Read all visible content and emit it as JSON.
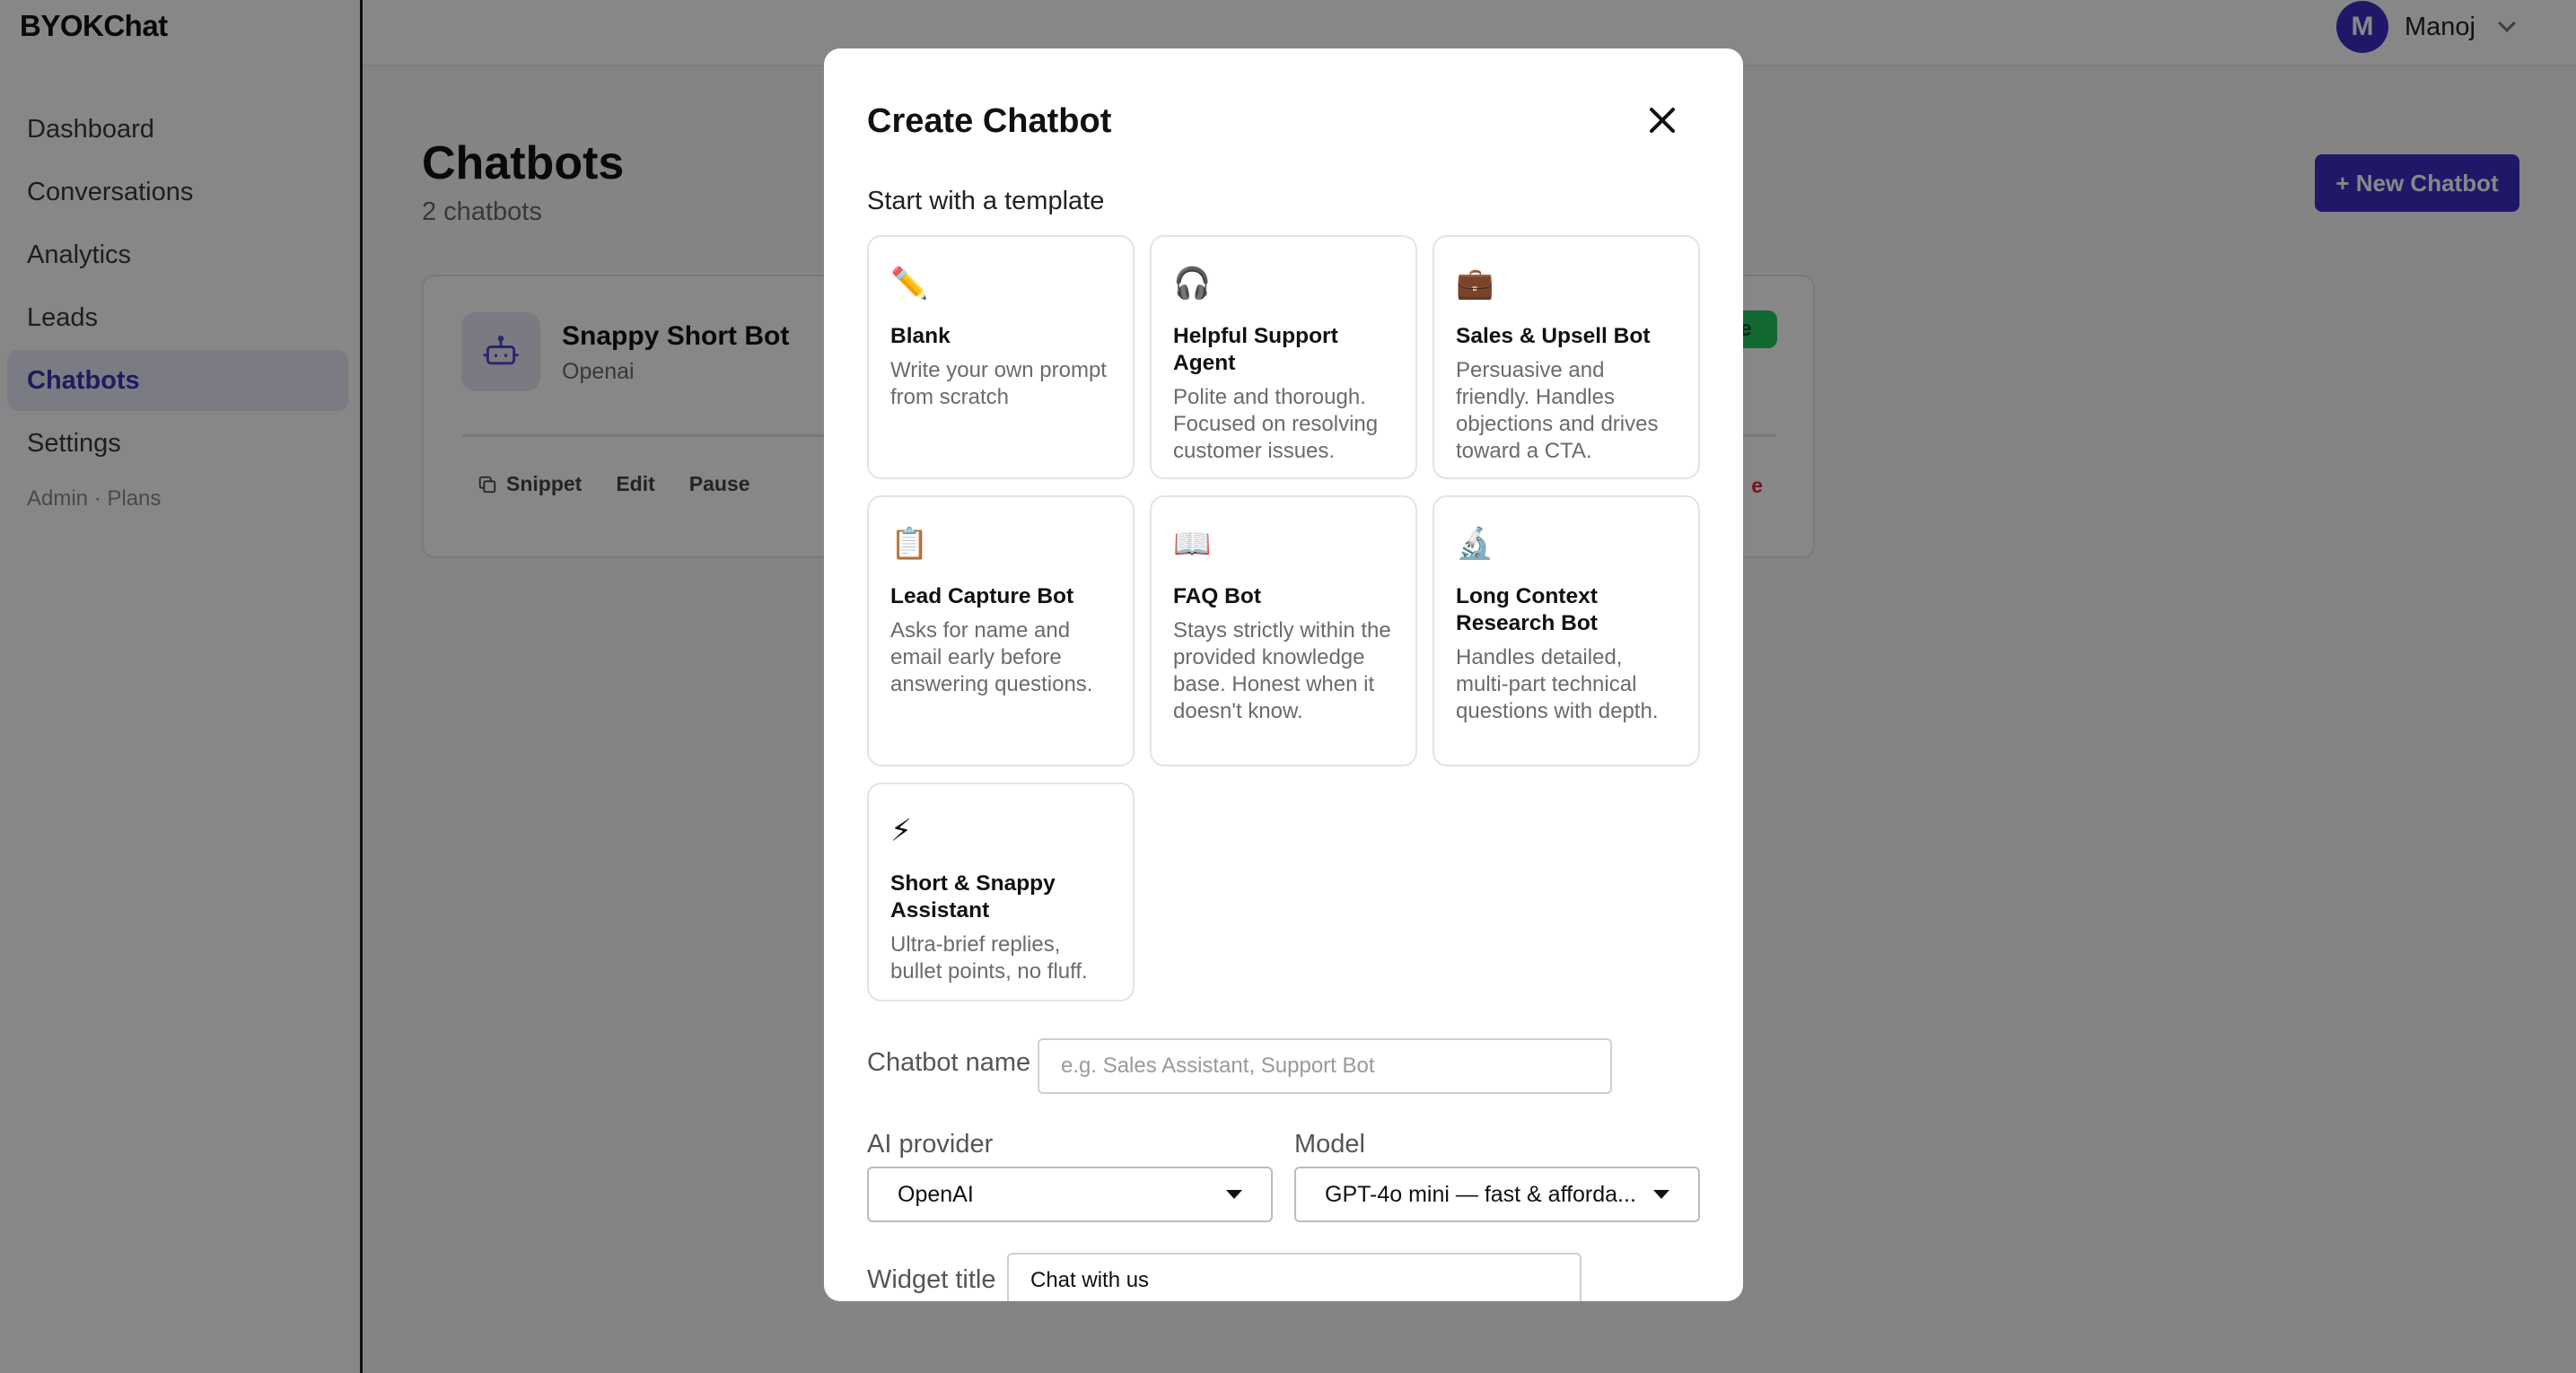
{
  "app": {
    "brand": "BYOKChat"
  },
  "sidebar": {
    "items": [
      {
        "label": "Dashboard"
      },
      {
        "label": "Conversations"
      },
      {
        "label": "Analytics"
      },
      {
        "label": "Leads"
      },
      {
        "label": "Chatbots",
        "active": true
      },
      {
        "label": "Settings"
      }
    ],
    "sub_link": "Admin · Plans"
  },
  "header": {
    "user_initial": "M",
    "user_name": "Manoj"
  },
  "page": {
    "title": "Chatbots",
    "subtitle": "2 chatbots",
    "new_button": "+ New Chatbot",
    "bot": {
      "name": "Snappy Short Bot",
      "provider": "Openai",
      "status": "e",
      "actions": {
        "snippet": "Snippet",
        "edit": "Edit",
        "pause": "Pause",
        "delete": "e"
      }
    }
  },
  "modal": {
    "title": "Create Chatbot",
    "section_label": "Start with a template",
    "templates": [
      {
        "icon": "✏️",
        "icon_name": "pencil-icon",
        "name": "Blank",
        "desc": "Write your own prompt from scratch"
      },
      {
        "icon": "🎧",
        "icon_name": "headphones-icon",
        "name": "Helpful Support Agent",
        "desc": "Polite and thorough. Focused on resolving customer issues."
      },
      {
        "icon": "💼",
        "icon_name": "briefcase-icon",
        "name": "Sales & Upsell Bot",
        "desc": "Persuasive and friendly. Handles objections and drives toward a CTA."
      },
      {
        "icon": "📋",
        "icon_name": "clipboard-icon",
        "name": "Lead Capture Bot",
        "desc": "Asks for name and email early before answering questions."
      },
      {
        "icon": "📖",
        "icon_name": "open-book-icon",
        "name": "FAQ Bot",
        "desc": "Stays strictly within the provided knowledge base. Honest when it doesn't know."
      },
      {
        "icon": "🔬",
        "icon_name": "microscope-icon",
        "name": "Long Context Research Bot",
        "desc": "Handles detailed, multi-part technical questions with depth."
      },
      {
        "icon": "⚡",
        "icon_name": "lightning-icon",
        "name": "Short & Snappy Assistant",
        "desc": "Ultra-brief replies, bullet points, no fluff."
      }
    ],
    "chatbot_name": {
      "label": "Chatbot name",
      "placeholder": "e.g. Sales Assistant, Support Bot",
      "value": ""
    },
    "ai_provider": {
      "label": "AI provider",
      "selected": "OpenAI"
    },
    "model": {
      "label": "Model",
      "selected": "GPT-4o mini — fast & afforda..."
    },
    "widget_title": {
      "label": "Widget title",
      "value": "Chat with us"
    }
  },
  "colors": {
    "accent": "#3b2fc7",
    "active_nav_bg": "#e9e8f7",
    "status_green": "#22c55e",
    "overlay": "rgba(0,0,0,0.47)"
  }
}
